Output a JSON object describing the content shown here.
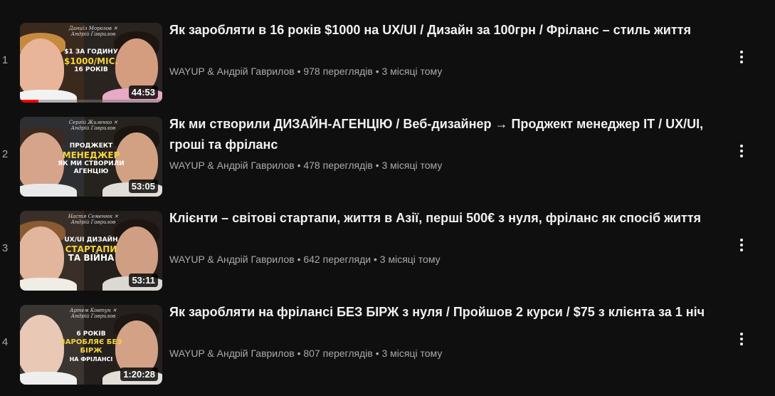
{
  "videos": [
    {
      "index": "1",
      "title": "Як заробляти в 16 років $1000 на UX/UI / Дизайн за 100грн / Фріланс – стиль життя",
      "channel": "WAYUP & Андрій Гаврилов",
      "views": "978 переглядів",
      "age": "3 місяці тому",
      "duration": "44:53",
      "thumb_names": "Даниїл Морозов  ✕  Андрій Гаврилов",
      "thumb_line1": "$1 ЗА ГОДИНУ",
      "thumb_line2": "$1000/МІС.",
      "thumb_line3": "16 РОКІВ",
      "progress": 0.13,
      "accent": "#f5d23a"
    },
    {
      "index": "2",
      "title": "Як ми створили ДИЗАЙН-АГЕНЦІЮ / Веб-дизайнер → Проджект менеджер IT / UX/UI, гроші та фріланс",
      "channel": "WAYUP & Андрій Гаврилов",
      "views": "478 переглядів",
      "age": "3 місяці тому",
      "duration": "53:05",
      "thumb_names": "Сергій Жиленко  ✕  Андрій Гаврилов",
      "thumb_line1": "ПРОДЖЕКТ",
      "thumb_line2": "МЕНЕДЖЕР",
      "thumb_line3": "ЯК МИ СТВОРИЛИ АГЕНЦІЮ",
      "progress": 0,
      "accent": "#f5d23a"
    },
    {
      "index": "3",
      "title": "Клієнти – світові стартапи, життя в Азії, перші 500€ з нуля, фріланс як спосіб життя",
      "channel": "WAYUP & Андрій Гаврилов",
      "views": "642 перегляди",
      "age": "3 місяці тому",
      "duration": "53:11",
      "thumb_names": "Настя Семенюк  ✕  Андрій Гаврилов",
      "thumb_line1": "UX/UI ДИЗАЙН",
      "thumb_line2": "СТАРТАПИ",
      "thumb_line3": "ТА ВІЙНА",
      "progress": 0,
      "accent": "#f5d23a"
    },
    {
      "index": "4",
      "title": "Як заробляти на фрілансі БЕЗ БІРЖ з нуля / Пройшов 2 курси / $75 з клієнта за 1 ніч",
      "channel": "WAYUP & Андрій Гаврилов",
      "views": "807 переглядів",
      "age": "3 місяці тому",
      "duration": "1:20:28",
      "thumb_names": "Артем Ковтун  ✕  Андрій Гаврилов",
      "thumb_line1": "6 РОКІВ",
      "thumb_line2": "ЗАРОБЛЯЄ БЕЗ БІРЖ",
      "thumb_line3": "НА ФРІЛАНСІ",
      "progress": 0,
      "accent": "#f5d23a"
    }
  ],
  "separator": "•",
  "menu_icon": "more-vert-icon"
}
